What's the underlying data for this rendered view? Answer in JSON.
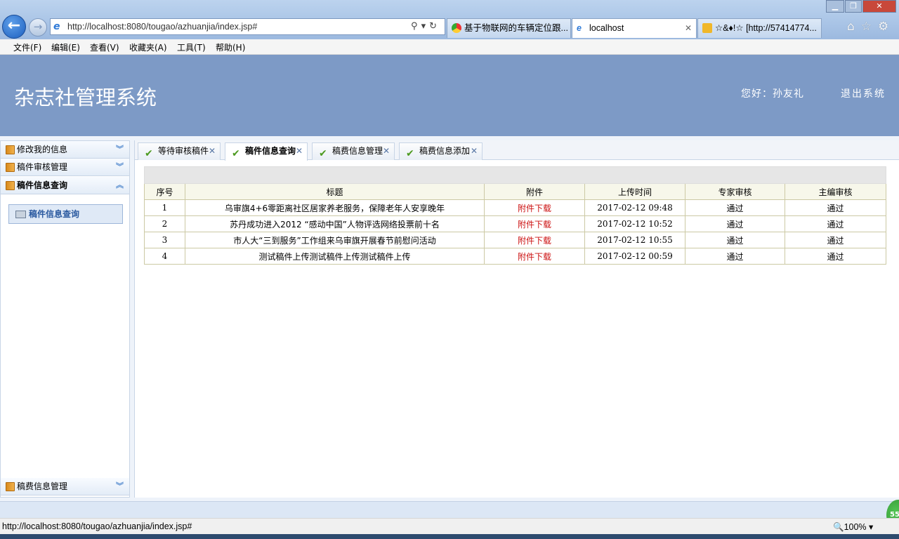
{
  "browser": {
    "url": "http://localhost:8080/tougao/azhuanjia/index.jsp#",
    "tabs": [
      {
        "label": "基于物联网的车辆定位跟..."
      },
      {
        "label": "localhost"
      },
      {
        "label": "☆&♦!☆ [http://57414774..."
      }
    ],
    "menu": [
      "文件(F)",
      "编辑(E)",
      "查看(V)",
      "收藏夹(A)",
      "工具(T)",
      "帮助(H)"
    ],
    "status_url": "http://localhost:8080/tougao/azhuanjia/index.jsp#",
    "zoom": "100%",
    "badge": "55"
  },
  "header": {
    "title": "杂志社管理系统",
    "greeting": "您好：孙友礼",
    "logout": "退出系统"
  },
  "sidebar": {
    "sections": [
      {
        "label": "修改我的信息",
        "state": "collapsed"
      },
      {
        "label": "稿件审核管理",
        "state": "collapsed"
      },
      {
        "label": "稿件信息查询",
        "state": "expanded"
      },
      {
        "label": "稿费信息管理",
        "state": "collapsed"
      }
    ],
    "active_item": "稿件信息查询"
  },
  "page_tabs": [
    {
      "label": "等待审核稿件"
    },
    {
      "label": "稿件信息查询"
    },
    {
      "label": "稿费信息管理"
    },
    {
      "label": "稿费信息添加"
    }
  ],
  "table": {
    "columns": [
      "序号",
      "标题",
      "附件",
      "上传时间",
      "专家审核",
      "主编审核"
    ],
    "rows": [
      [
        "1",
        "乌审旗4+6零距离社区居家养老服务，保障老年人安享晚年",
        "附件下载",
        "2017-02-12 09:48",
        "通过",
        "通过"
      ],
      [
        "2",
        "苏丹成功进入2012 “感动中国”人物评选网络投票前十名",
        "附件下载",
        "2017-02-12 10:52",
        "通过",
        "通过"
      ],
      [
        "3",
        "市人大“三到服务”工作组来乌审旗开展春节前慰问活动",
        "附件下载",
        "2017-02-12 10:55",
        "通过",
        "通过"
      ],
      [
        "4",
        "测试稿件上传测试稿件上传测试稿件上传",
        "附件下载",
        "2017-02-12 00:59",
        "通过",
        "通过"
      ]
    ]
  }
}
